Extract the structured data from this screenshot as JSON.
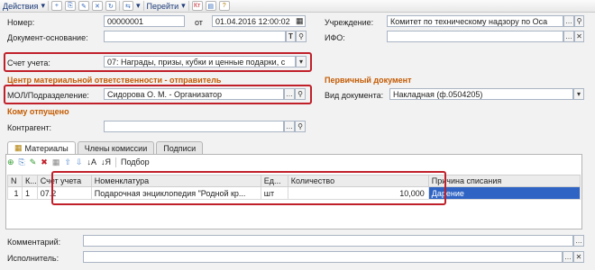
{
  "toolbar": {
    "actions_label": "Действия",
    "goto_label": "Перейти"
  },
  "header": {
    "number_label": "Номер:",
    "number_value": "00000001",
    "from_label": "от",
    "date_value": "01.04.2016 12:00:02",
    "basis_label": "Документ-основание:",
    "basis_value": "",
    "account_label": "Счет учета:",
    "account_value": "07: Награды, призы, кубки и ценные подарки, с",
    "institution_label": "Учреждение:",
    "institution_value": "Комитет по техническому надзору по Оса",
    "ifo_label": "ИФО:",
    "ifo_value": ""
  },
  "sections": {
    "center": "Центр материальной ответственности - отправитель",
    "primary_doc": "Первичный документ",
    "recipient": "Кому отпущено"
  },
  "mol": {
    "label": "МОЛ/Подразделение:",
    "value": "Сидорова О. М. - Организатор"
  },
  "doc_type": {
    "label": "Вид документа:",
    "value": "Накладная (ф.0504205)"
  },
  "contractor": {
    "label": "Контрагент:",
    "value": ""
  },
  "tabs": [
    {
      "label": "Материалы"
    },
    {
      "label": "Члены комиссии"
    },
    {
      "label": "Подписи"
    }
  ],
  "panel_toolbar": {
    "selection_label": "Подбор"
  },
  "table": {
    "headers": [
      "N",
      "К...",
      "Счет учета",
      "Номенклатура",
      "Ед...",
      "Количество",
      "Причина списания"
    ],
    "rows": [
      [
        "1",
        "1",
        "07.2",
        "Подарочная энциклопедия \"Родной кр...",
        "шт",
        "10,000",
        "Дарение"
      ]
    ]
  },
  "footer": {
    "comment_label": "Комментарий:",
    "comment_value": "",
    "executor_label": "Исполнитель:",
    "executor_value": ""
  },
  "colors": {
    "section": "#c45a00",
    "highlight": "#c0202a",
    "selection": "#2f64c4"
  }
}
